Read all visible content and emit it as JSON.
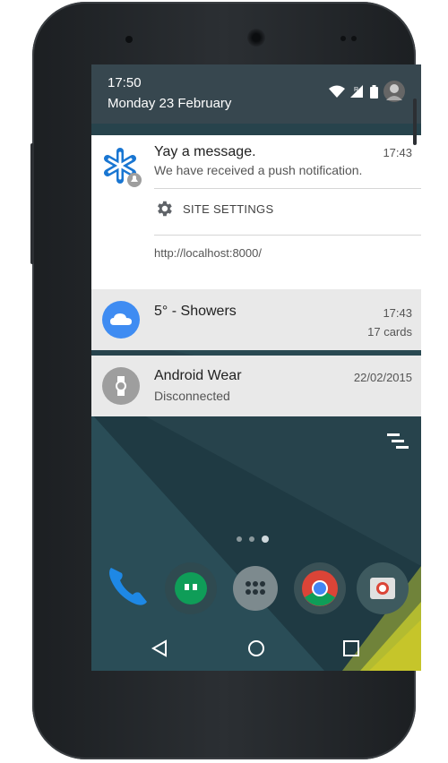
{
  "status_bar": {
    "time": "17:50",
    "date": "Monday 23 February"
  },
  "notifications": [
    {
      "app_icon": "asterisk-icon",
      "title": "Yay a message.",
      "time": "17:43",
      "body": "We have received a push notification.",
      "action_label": "SITE SETTINGS",
      "action_icon": "gear-icon",
      "origin": "http://localhost:8000/"
    },
    {
      "app_icon": "cloud-icon",
      "title": "5° - Showers",
      "time": "17:43",
      "detail": "17 cards",
      "accent": "#3f8cf2"
    },
    {
      "app_icon": "watch-icon",
      "title": "Android Wear",
      "time": "22/02/2015",
      "body": "Disconnected"
    }
  ],
  "dock": {
    "apps": [
      "phone-icon",
      "hangouts-icon",
      "app-drawer-icon",
      "chrome-icon",
      "photos-icon"
    ]
  },
  "nav": {
    "buttons": [
      "back-icon",
      "home-icon",
      "recents-icon"
    ]
  },
  "colors": {
    "status_bar": "#37474f",
    "notification_bg": "#ffffff",
    "dimmed_notification_bg": "#e9e9e9",
    "cloud_blue": "#3f8cf2",
    "asterisk_blue": "#1976d2",
    "wallpaper_dark": "#263238"
  }
}
